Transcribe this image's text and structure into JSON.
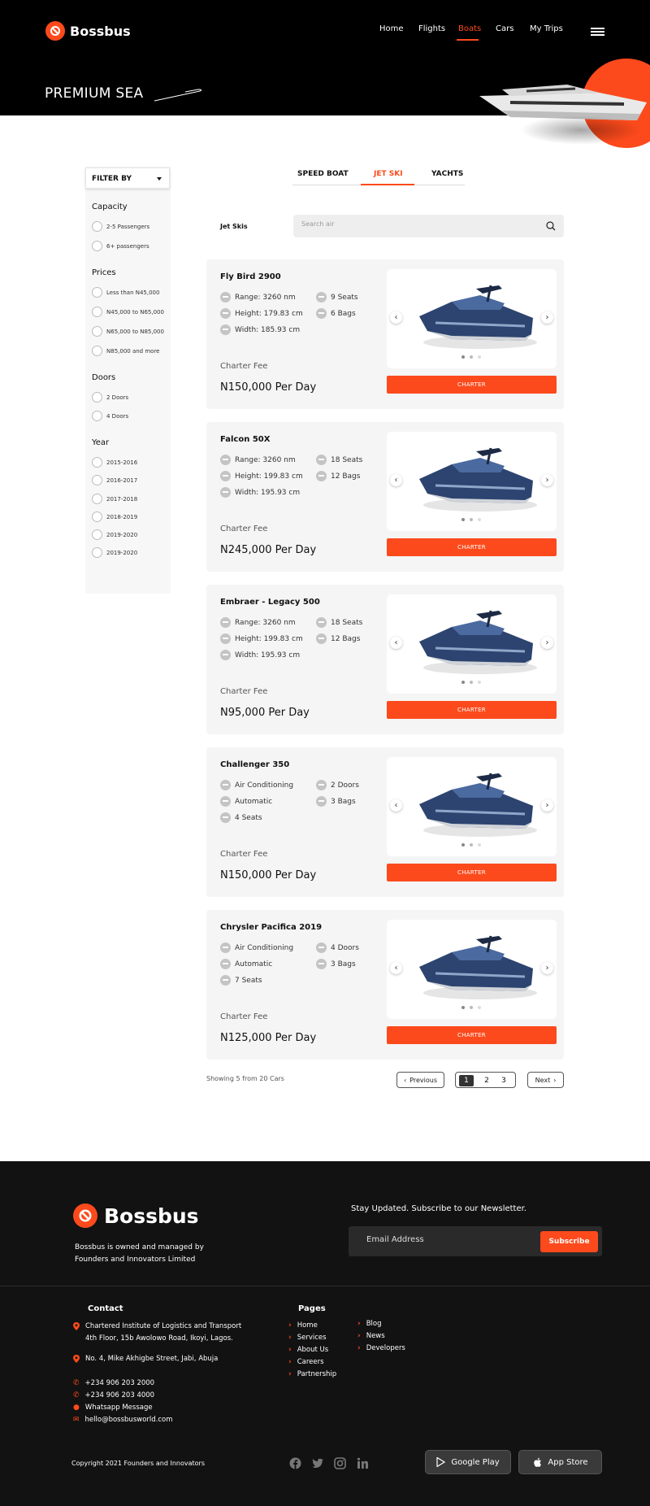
{
  "brand": {
    "name": "Bossbus",
    "color": "#fd4a1c"
  },
  "nav": {
    "items": [
      "Home",
      "Flights",
      "Boats",
      "Cars",
      "My Trips"
    ],
    "active": "Boats"
  },
  "hero": {
    "title": "PREMIUM SEA"
  },
  "filters": {
    "button_label": "FILTER BY",
    "groups": [
      {
        "title": "Capacity",
        "options": [
          "2-5 Passengers",
          "6+ passengers"
        ]
      },
      {
        "title": "Prices",
        "options": [
          "Less than N45,000",
          "N45,000 to N65,000",
          "N65,000 to N85,000",
          "N85,000 and more"
        ]
      },
      {
        "title": "Doors",
        "options": [
          "2 Doors",
          "4 Doors"
        ]
      },
      {
        "title": "Year",
        "options": [
          "2015-2016",
          "2016-2017",
          "2017-2018",
          "2018-2019",
          "2019-2020",
          "2019-2020"
        ]
      }
    ]
  },
  "tabs": {
    "items": [
      "SPEED BOAT",
      "JET SKI",
      "YACHTS"
    ],
    "active": "JET SKI"
  },
  "search": {
    "label": "Jet Skis",
    "placeholder": "Search air"
  },
  "listings": [
    {
      "title": "Fly Bird 2900",
      "features_left": [
        "Range: 3260 nm",
        "Height: 179.83 cm",
        "Width: 185.93 cm"
      ],
      "features_right": [
        "9 Seats",
        "6 Bags"
      ],
      "fee_label": "Charter Fee",
      "price": "N150,000 Per Day",
      "button": "CHARTER"
    },
    {
      "title": "Falcon 50X",
      "features_left": [
        "Range: 3260 nm",
        "Height: 199.83 cm",
        "Width: 195.93 cm"
      ],
      "features_right": [
        "18 Seats",
        "12 Bags"
      ],
      "fee_label": "Charter Fee",
      "price": "N245,000 Per Day",
      "button": "CHARTER"
    },
    {
      "title": "Embraer - Legacy 500",
      "features_left": [
        "Range: 3260 nm",
        "Height: 199.83 cm",
        "Width: 195.93 cm"
      ],
      "features_right": [
        "18 Seats",
        "12 Bags"
      ],
      "fee_label": "Charter Fee",
      "price": "N95,000 Per Day",
      "button": "CHARTER"
    },
    {
      "title": "Challenger 350",
      "features_left": [
        "Air Conditioning",
        "Automatic",
        "4 Seats"
      ],
      "features_right": [
        "2 Doors",
        "3 Bags"
      ],
      "fee_label": "Charter Fee",
      "price": "N150,000 Per Day",
      "button": "CHARTER"
    },
    {
      "title": "Chrysler Pacifica 2019",
      "features_left": [
        "Air Conditioning",
        "Automatic",
        "7 Seats"
      ],
      "features_right": [
        "4 Doors",
        "3 Bags"
      ],
      "fee_label": "Charter Fee",
      "price": "N125,000 Per Day",
      "button": "CHARTER"
    }
  ],
  "pagination": {
    "showing": "Showing 5 from 20 Cars",
    "previous": "Previous",
    "next": "Next",
    "pages": [
      "1",
      "2",
      "3"
    ],
    "current": "1"
  },
  "footer": {
    "brand": "Bossbus",
    "description": "Bossbus is owned and managed by Founders and Innovators Limited",
    "newsletter_title": "Stay Updated. Subscribe to our Newsletter.",
    "email_placeholder": "Email Address",
    "subscribe": "Subscribe",
    "contact_title": "Contact",
    "address1_line1": "Chartered Institute of Logistics and Transport",
    "address1_line2": "4th Floor, 15b Awolowo Road, Ikoyi, Lagos.",
    "address2": "No. 4, Mike Akhigbe Street, Jabi, Abuja",
    "phone1": "+234 906 203 2000",
    "phone2": "+234 906 203 4000",
    "whatsapp": "Whatsapp Message",
    "email": "hello@bossbusworld.com",
    "pages_title": "Pages",
    "pages_col1": [
      "Home",
      "Services",
      "About Us",
      "Careers",
      "Partnership"
    ],
    "pages_col2": [
      "Blog",
      "News",
      "Developers"
    ],
    "copyright": "Copyright 2021 Founders and Innovators",
    "google_play": "Google Play",
    "app_store": "App Store"
  }
}
